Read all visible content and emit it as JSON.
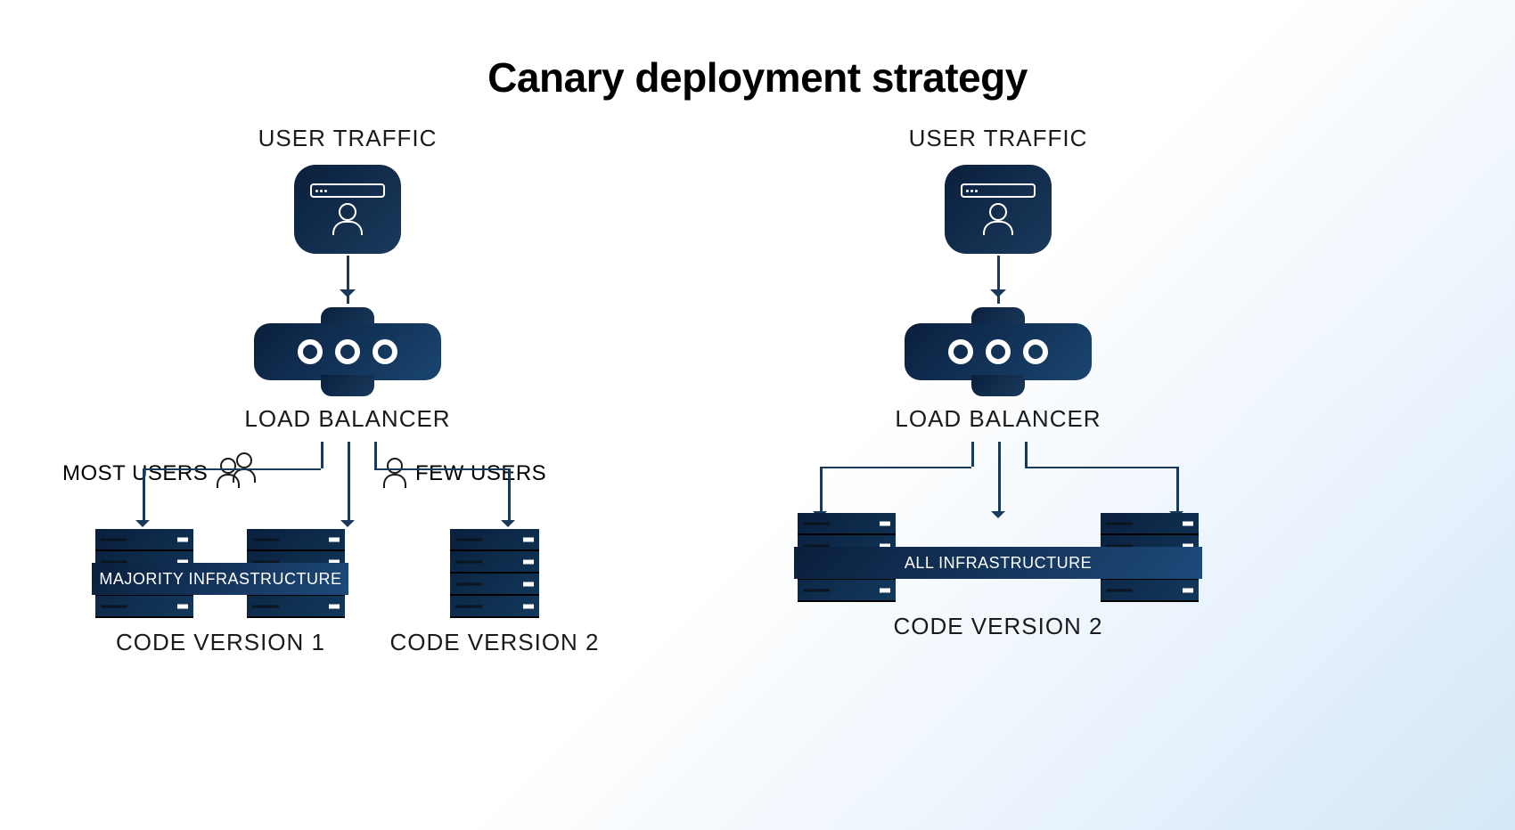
{
  "title": "Canary deployment strategy",
  "labels": {
    "user_traffic": "USER TRAFFIC",
    "load_balancer": "LOAD BALANCER",
    "most_users": "MOST USERS",
    "few_users": "FEW USERS",
    "majority_infra": "MAJORITY INFRASTRUCTURE",
    "all_infra": "ALL INFRASTRUCTURE",
    "code_v1": "CODE VERSION 1",
    "code_v2": "CODE VERSION 2"
  }
}
